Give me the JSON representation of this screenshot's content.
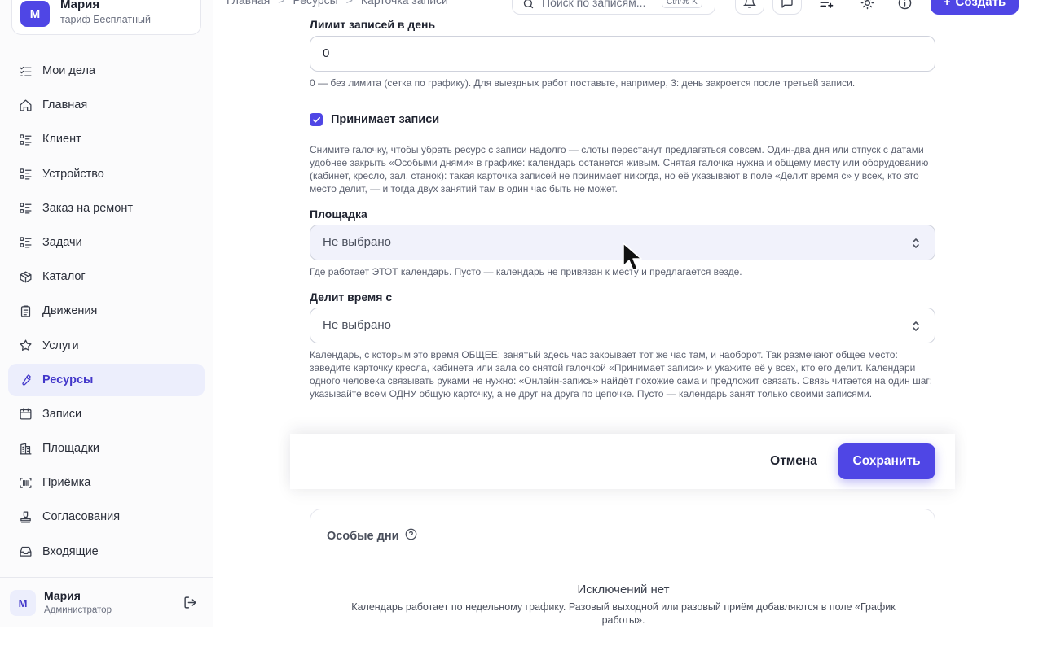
{
  "org": {
    "avatar": "М",
    "name": "Мария",
    "plan": "тариф Бесплатный"
  },
  "sidebar": {
    "items": [
      {
        "label": "Мои дела",
        "icon": "checklist-icon"
      },
      {
        "label": "Главная",
        "icon": "home-icon"
      },
      {
        "label": "Клиент",
        "icon": "list-icon"
      },
      {
        "label": "Устройство",
        "icon": "list-icon"
      },
      {
        "label": "Заказ на ремонт",
        "icon": "list-icon"
      },
      {
        "label": "Задачи",
        "icon": "list-icon"
      },
      {
        "label": "Каталог",
        "icon": "box-icon"
      },
      {
        "label": "Движения",
        "icon": "clipboard-icon"
      },
      {
        "label": "Услуги",
        "icon": "star-icon"
      },
      {
        "label": "Ресурсы",
        "icon": "wrench-icon",
        "active": true
      },
      {
        "label": "Записи",
        "icon": "calendar-icon"
      },
      {
        "label": "Площадки",
        "icon": "building-icon"
      },
      {
        "label": "Приёмка",
        "icon": "barcode-icon"
      },
      {
        "label": "Согласования",
        "icon": "stamp-icon"
      },
      {
        "label": "Входящие",
        "icon": "inbox-icon"
      }
    ]
  },
  "user": {
    "avatar": "М",
    "name": "Мария",
    "role": "Администратор"
  },
  "topbar": {
    "crumbs": [
      "Главная",
      "Ресурсы",
      "Карточка записи"
    ],
    "search_placeholder": "Поиск по записям...",
    "search_shortcut": "Ctrl/⌘ K",
    "create_label": "Создать"
  },
  "form": {
    "daily_limit_label": "Лимит записей в день",
    "daily_limit_value": "0",
    "daily_limit_hint": "0 — без лимита (сетка по графику). Для выездных работ поставьте, например, 3: день закроется после третьей записи.",
    "accepts_label": "Принимает записи",
    "accepts_checked": true,
    "accepts_hint": "Снимите галочку, чтобы убрать ресурс с записи надолго — слоты перестанут предлагаться совсем. Один-два дня или отпуск с датами удобнее закрыть «Особыми днями» в графике: календарь останется живым. Снятая галочка нужна и общему месту или оборудованию (кабинет, кресло, зал, станок): такая карточка записей не принимает никогда, но её указывают в поле «Делит время с» у всех, кто это место делит, — и тогда двух занятий там в один час быть не может.",
    "venue_label": "Площадка",
    "venue_value": "Не выбрано",
    "venue_hint": "Где работает ЭТОТ календарь. Пусто — календарь не привязан к месту и предлагается везде.",
    "shares_label": "Делит время с",
    "shares_value": "Не выбрано",
    "shares_hint": "Календарь, с которым это время ОБЩЕЕ: занятый здесь час закрывает тот же час там, и наоборот. Так размечают общее место: заведите карточку кресла, кабинета или зала со снятой галочкой «Принимает записи» и укажите её у всех, кто его делит. Календари одного человека связывать руками не нужно: «Онлайн-запись» найдёт похожие сама и предложит связать. Связь читается на один шаг: указывайте всем ОДНУ общую карточку, а не друг на друга по цепочке. Пусто — календарь занят только своими записями."
  },
  "actions": {
    "cancel_label": "Отмена",
    "save_label": "Сохранить"
  },
  "special_days": {
    "title": "Особые дни",
    "empty_title": "Исключений нет",
    "empty_text": "Календарь работает по недельному графику. Разовый выходной или разовый приём добавляются в поле «График работы»."
  },
  "colors": {
    "accent": "#4f46e5",
    "active_bg": "#eceefc"
  }
}
